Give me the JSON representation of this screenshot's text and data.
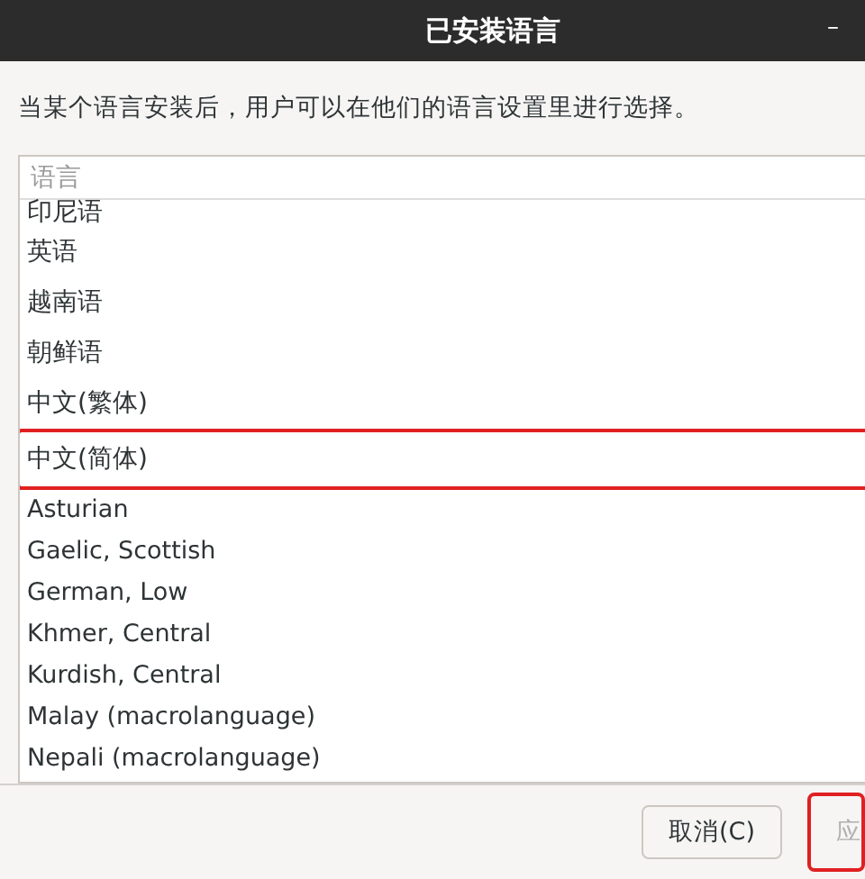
{
  "window": {
    "title": "已安装语言",
    "minimize": "–"
  },
  "description": "当某个语言安装后，用户可以在他们的语言设置里进行选择。",
  "search": {
    "placeholder": "语言"
  },
  "languages": [
    {
      "label": "印尼语",
      "selected": false
    },
    {
      "label": "英语",
      "selected": false
    },
    {
      "label": "越南语",
      "selected": false
    },
    {
      "label": "朝鲜语",
      "selected": false
    },
    {
      "label": "中文(繁体)",
      "selected": false
    },
    {
      "label": "中文(简体)",
      "selected": true
    },
    {
      "label": "Asturian",
      "selected": false
    },
    {
      "label": "Gaelic, Scottish",
      "selected": false
    },
    {
      "label": "German, Low",
      "selected": false
    },
    {
      "label": "Khmer, Central",
      "selected": false
    },
    {
      "label": "Kurdish, Central",
      "selected": false
    },
    {
      "label": "Malay (macrolanguage)",
      "selected": false
    },
    {
      "label": "Nepali (macrolanguage)",
      "selected": false
    }
  ],
  "buttons": [
    {
      "label": "取消(C)",
      "disabled": false,
      "highlighted": false
    },
    {
      "label": "应",
      "disabled": true,
      "highlighted": true
    }
  ]
}
